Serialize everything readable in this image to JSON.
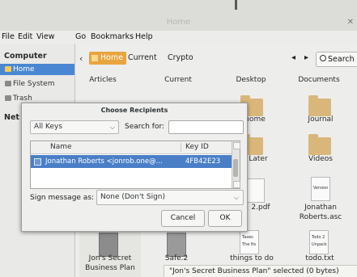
{
  "window": {
    "title": "Home"
  },
  "menubar": [
    "File",
    "Edit",
    "View",
    "Go",
    "Bookmarks",
    "Help"
  ],
  "sidebar": {
    "header_computer": "Computer",
    "items": [
      {
        "label": "Home",
        "icon": "home-folder-icon",
        "active": true
      },
      {
        "label": "File System",
        "icon": "drive-icon",
        "active": false
      },
      {
        "label": "Trash",
        "icon": "trash-icon",
        "active": false
      }
    ],
    "header_network_partial": "Net"
  },
  "toolbar": {
    "breadcrumbs": [
      "Home",
      "Current",
      "Crypto"
    ],
    "search_label": "Search"
  },
  "files": [
    {
      "name": "Articles",
      "icon": "folder-icon"
    },
    {
      "name": "Current",
      "icon": "folder-icon"
    },
    {
      "name": "Desktop",
      "icon": "folder-icon"
    },
    {
      "name": "Documents",
      "icon": "folder-icon"
    },
    {
      "name": "home",
      "icon": "folder-icon"
    },
    {
      "name": "Journal",
      "icon": "folder-icon"
    },
    {
      "name": "Later",
      "icon": "folder-icon"
    },
    {
      "name": "Videos",
      "icon": "folder-icon"
    },
    {
      "name": "2.pdf",
      "icon": "pdf-icon"
    },
    {
      "name_lines": [
        "Jonathan",
        "Roberts.asc"
      ],
      "icon": "text-file-icon",
      "thumb_lines": [
        "Version"
      ]
    },
    {
      "name_lines": [
        "Jon's Secret",
        "Business Plan"
      ],
      "icon": "document-icon",
      "selected": true
    },
    {
      "name": "Safe.2",
      "icon": "document-icon"
    },
    {
      "name": "things to do",
      "icon": "text-file-icon",
      "thumb_lines": [
        "Taxes",
        "The fts"
      ]
    },
    {
      "name": "todo.txt",
      "icon": "text-file-icon",
      "thumb_lines": [
        "Todo 2",
        "Unpack"
      ]
    }
  ],
  "statusbar": {
    "text": "\"Jon's Secret Business Plan\" selected (0 bytes)"
  },
  "dialog": {
    "title": "Choose Recipients",
    "keys_filter": "All Keys",
    "search_label": "Search for:",
    "search_value": "",
    "columns": [
      "Name",
      "Key ID"
    ],
    "rows": [
      {
        "name": "Jonathan Roberts <jonrob.one@...",
        "key_id": "4FB42E23",
        "selected": true
      }
    ],
    "sign_label": "Sign message as:",
    "sign_value": "None (Don't Sign)",
    "cancel_label": "Cancel",
    "ok_label": "OK"
  },
  "colors": {
    "accent": "#4a87d3",
    "breadcrumb_active": "#e9a43e",
    "folder": "#d9b77b",
    "list_selection": "#4a7fc7"
  }
}
